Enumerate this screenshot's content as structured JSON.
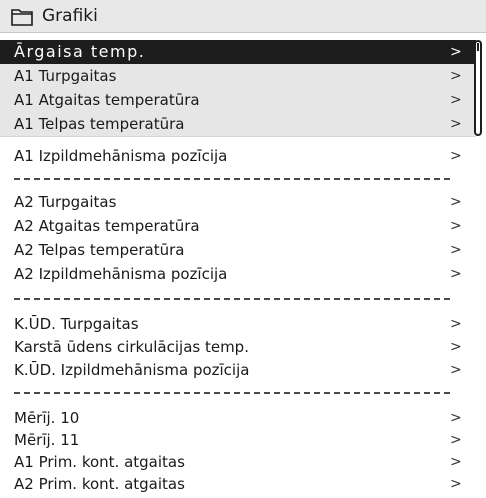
{
  "header": {
    "title": "Grafiki",
    "icon": "folder-icon"
  },
  "chevron": ">",
  "items": [
    {
      "label": "Ārgaisa temp.",
      "state": "selected"
    },
    {
      "label": "A1 Turpgaitas",
      "state": "shaded"
    },
    {
      "label": "A1 Atgaitas temperatūra",
      "state": "shaded"
    },
    {
      "label": "A1 Telpas temperatūra",
      "state": "shaded"
    },
    {
      "label": "A1 Izpildmehānisma pozīcija",
      "state": "normal"
    },
    {
      "label": "A2 Turpgaitas",
      "state": "normal"
    },
    {
      "label": "A2 Atgaitas temperatūra",
      "state": "normal"
    },
    {
      "label": "A2 Telpas temperatūra",
      "state": "normal"
    },
    {
      "label": "A2 Izpildmehānisma pozīcija",
      "state": "normal"
    },
    {
      "label": "K.ŪD. Turpgaitas",
      "state": "normal"
    },
    {
      "label": "Karstā ūdens cirkulācijas temp.",
      "state": "normal"
    },
    {
      "label": "K.ŪD. Izpildmehānisma pozīcija",
      "state": "normal"
    },
    {
      "label": "Mērīj. 10",
      "state": "normal"
    },
    {
      "label": "Mērīj. 11",
      "state": "normal"
    },
    {
      "label": "A1 Prim. kont. atgaitas",
      "state": "normal"
    },
    {
      "label": "A2 Prim. kont. atgaitas",
      "state": "normal"
    }
  ],
  "colors": {
    "selected_bg": "#1d1d1d",
    "shaded_bg": "#e6e6e6",
    "header_bg": "#e8e8e8"
  }
}
